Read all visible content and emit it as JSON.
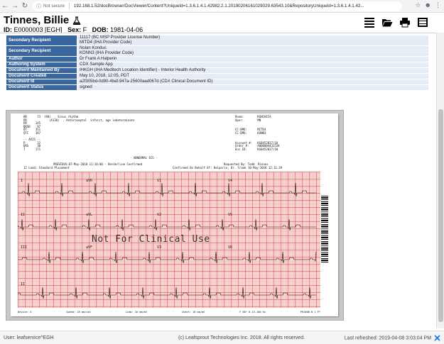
{
  "browser": {
    "security_label": "Not secure",
    "url": "192.168.1.52/docBrowser/DocViewer/Content?UniqueId=1.3.6.1.4.1.42982.2.1.20190206161029029.63543.10&RepositoryUniqueId=1.3.6.1.4.1.42..."
  },
  "patient": {
    "name": "Tinnes, Billie",
    "id_label": "ID:",
    "id": "E0000003 [EGH]",
    "sex_label": "Sex:",
    "sex": "F",
    "dob_label": "DOB:",
    "dob": "1981-04-06"
  },
  "toolbar": {
    "icons": [
      "list-icon",
      "folder-open-icon",
      "print-icon",
      "film-icon"
    ]
  },
  "meta_rows": [
    {
      "key": "Secondary Recipient",
      "lines": [
        "11117 (BC MSP Provider License Number)",
        "MITD4 (IHA Provider Code)"
      ]
    },
    {
      "key": "Secondary Recipient",
      "lines": [
        "Nolan Konduc",
        "KONN3 (IHA Provider Code)"
      ]
    },
    {
      "key": "Author",
      "lines": [
        "Dr Frank A Halperin"
      ]
    },
    {
      "key": "Authoring System",
      "lines": [
        "CDX Sample App"
      ]
    },
    {
      "key": "Document Maintained By",
      "lines": [
        "IHKGH (IHA Meditech Location Identifier) - Interior Health Authority"
      ]
    },
    {
      "key": "Document Created",
      "lines": [
        "May 10, 2018, 12:05, PDT"
      ]
    },
    {
      "key": "Document Id",
      "lines": [
        "a2f305bd-0d90-4baf-947a-25600aad067d (CDX Clinical Document ID)"
      ]
    },
    {
      "key": "Document Status",
      "lines": [
        "signed"
      ]
    }
  ],
  "ecg": {
    "measurements": "HR      73  (90)  . Sinus rhythm\nPR             (A13Q)  . Anteroseptal  infarct, age indeterminate\nPR     145\nQRSD    97\nQT     351\nQTC    387\n\n-- AXIS --\nP       32\nQRS     30\nT      171",
    "abnormal": "- ABNORMAL ECG -",
    "right_info": "Room:        KGHCHICA\nOper:        MN\n\n\nCC-DMO:      MITD4\nCC-DMO:      KONN3\n\n\nAccount #:   KG0452037/10\nOrder #:     A00000443152K\nEnc ID:      KG0452037/10",
    "previous": "PREVIOUS:07-May-2018 11:10:00 - Borderline Confirmed",
    "requested": "Requested By: Todd  Rinnes",
    "lead_placement": "12 Lead; Standard Placement",
    "confirmed": "Confirmed On Behalf Of: Halperin, Dr. Frank 10-May-2018 12:11:39",
    "leads": [
      "I",
      "aVR",
      "V1",
      "V4",
      "II",
      "aVL",
      "V2",
      "V5",
      "III",
      "aVF",
      "V3",
      "V6",
      "II"
    ],
    "watermark": "Not For Clinical Use",
    "footer": [
      "Device: 4",
      "Speed: 25 mm/sec",
      "Limb: 10 mm/mV",
      "Chest: 10 mm/mV",
      "F 60~ 0.15-100 Hz",
      "PH100B B 1 P?"
    ]
  },
  "status": {
    "user": "User: leafservice^EGH",
    "copyright": "(c) Leafsprout Technologies Inc. 2018.  All rights reserved.",
    "refresh": "Last refreshed: 2019-04-08 3:03:04 PM"
  }
}
